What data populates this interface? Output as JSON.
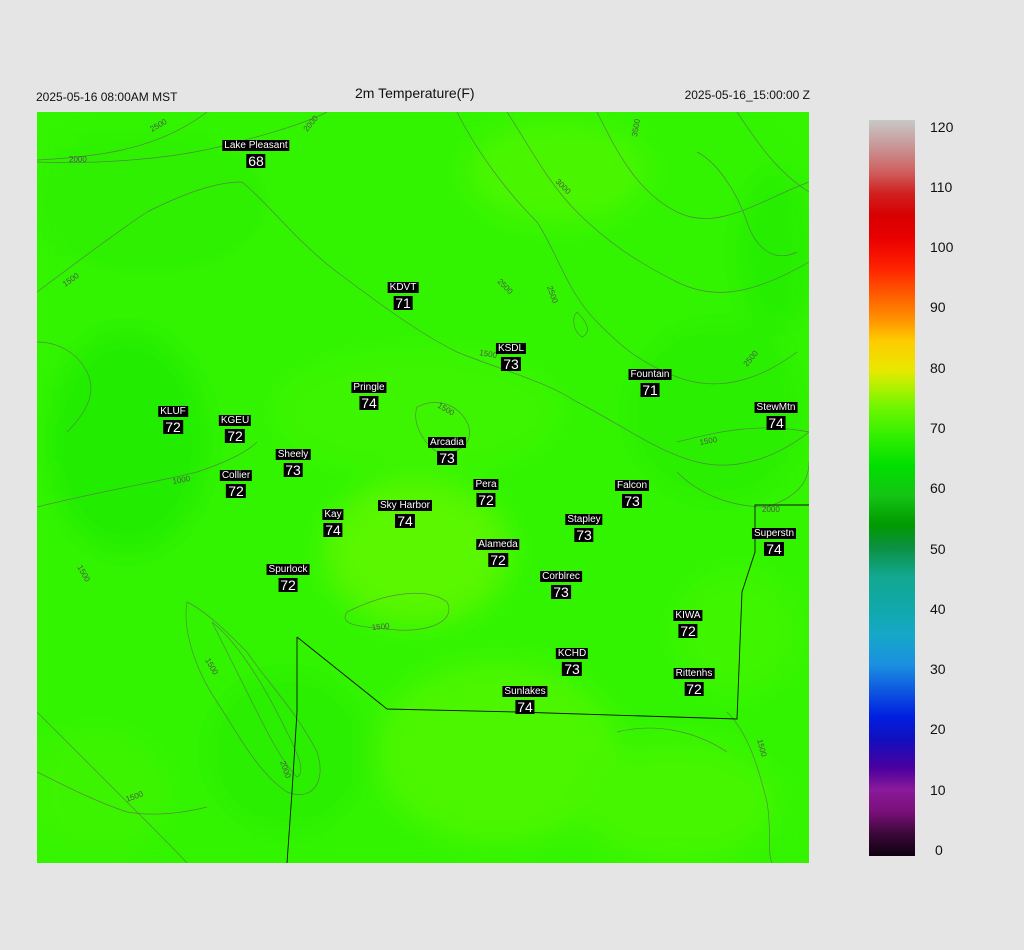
{
  "header": {
    "valid_local": "2025-05-16 08:00AM MST",
    "title": "2m Temperature(F)",
    "valid_utc": "2025-05-16_15:00:00 Z"
  },
  "stations": [
    {
      "name": "Lake Pleasant",
      "value": "68"
    },
    {
      "name": "KDVT",
      "value": "71"
    },
    {
      "name": "KSDL",
      "value": "73"
    },
    {
      "name": "Fountain",
      "value": "71"
    },
    {
      "name": "StewMtn",
      "value": "74"
    },
    {
      "name": "Pringle",
      "value": "74"
    },
    {
      "name": "KLUF",
      "value": "72"
    },
    {
      "name": "KGEU",
      "value": "72"
    },
    {
      "name": "Arcadia",
      "value": "73"
    },
    {
      "name": "Sheely",
      "value": "73"
    },
    {
      "name": "Collier",
      "value": "72"
    },
    {
      "name": "Pera",
      "value": "72"
    },
    {
      "name": "Falcon",
      "value": "73"
    },
    {
      "name": "Kay",
      "value": "74"
    },
    {
      "name": "Sky Harbor",
      "value": "74"
    },
    {
      "name": "Stapley",
      "value": "73"
    },
    {
      "name": "Superstn",
      "value": "74"
    },
    {
      "name": "Alameda",
      "value": "72"
    },
    {
      "name": "Spurlock",
      "value": "72"
    },
    {
      "name": "Corblrec",
      "value": "73"
    },
    {
      "name": "KIWA",
      "value": "72"
    },
    {
      "name": "KCHD",
      "value": "73"
    },
    {
      "name": "Rittenhs",
      "value": "72"
    },
    {
      "name": "Sunlakes",
      "value": "74"
    }
  ],
  "contour_labels": [
    "2500",
    "2000",
    "2000",
    "3000",
    "3500",
    "1500",
    "2500",
    "2500",
    "1500",
    "1500",
    "2500",
    "1500",
    "1000",
    "1500",
    "2000",
    "1500",
    "1500",
    "2000",
    "1500",
    "1500"
  ],
  "colorbar": {
    "ticks": [
      "120",
      "110",
      "100",
      "90",
      "80",
      "70",
      "60",
      "50",
      "40",
      "30",
      "20",
      "10",
      "0"
    ],
    "min": 0,
    "max": 120
  }
}
